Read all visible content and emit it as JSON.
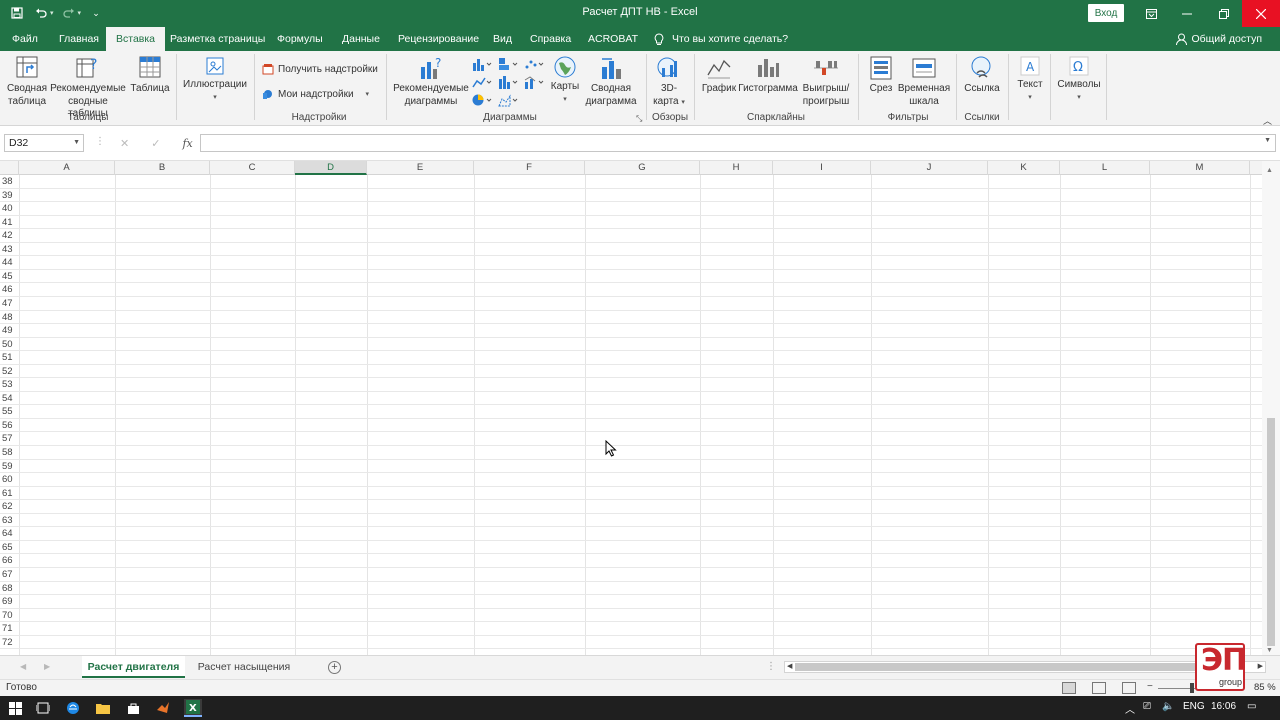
{
  "window": {
    "title": "Расчет ДПТ НВ  -  Excel",
    "signin_label": "Вход"
  },
  "tabs": [
    {
      "label": "Файл",
      "active": false
    },
    {
      "label": "Главная",
      "active": false
    },
    {
      "label": "Вставка",
      "active": true
    },
    {
      "label": "Разметка страницы",
      "active": false
    },
    {
      "label": "Формулы",
      "active": false
    },
    {
      "label": "Данные",
      "active": false
    },
    {
      "label": "Рецензирование",
      "active": false
    },
    {
      "label": "Вид",
      "active": false
    },
    {
      "label": "Справка",
      "active": false
    },
    {
      "label": "ACROBAT",
      "active": false
    }
  ],
  "tellme": "Что вы хотите сделать?",
  "share_label": "Общий доступ",
  "ribbon": {
    "pivot": [
      "Сводная",
      "таблица"
    ],
    "recpivot": [
      "Рекомендуемые",
      "сводные таблицы"
    ],
    "table": "Таблица",
    "group_tables": "Таблицы",
    "illustrations": "Иллюстрации",
    "get_addins": "Получить надстройки",
    "my_addins": "Мои надстройки",
    "group_addins": "Надстройки",
    "recchart": [
      "Рекомендуемые",
      "диаграммы"
    ],
    "maps": "Карты",
    "pivotchart": [
      "Сводная",
      "диаграмма"
    ],
    "group_charts": "Диаграммы",
    "map3d": [
      "3D-",
      "карта"
    ],
    "group_tours": "Обзоры",
    "spark_line": "График",
    "spark_column": "Гистограмма",
    "spark_winloss": [
      "Выигрыш/",
      "проигрыш"
    ],
    "group_sparklines": "Спарклайны",
    "slicer": "Срез",
    "timeline": [
      "Временная",
      "шкала"
    ],
    "group_filters": "Фильтры",
    "link": "Ссылка",
    "group_links": "Ссылки",
    "text": "Текст",
    "symbols": "Символы"
  },
  "formula_bar": {
    "name_box": "D32",
    "formula": ""
  },
  "columns": [
    "A",
    "B",
    "C",
    "D",
    "E",
    "F",
    "G",
    "H",
    "I",
    "J",
    "K",
    "L",
    "M"
  ],
  "selected_column": "D",
  "rows": [
    "38",
    "39",
    "40",
    "41",
    "42",
    "43",
    "44",
    "45",
    "46",
    "47",
    "48",
    "49",
    "50",
    "51",
    "52",
    "53",
    "54",
    "55",
    "56",
    "57",
    "58",
    "59",
    "60",
    "61",
    "62",
    "63",
    "64",
    "65",
    "66",
    "67",
    "68",
    "69",
    "70",
    "71",
    "72"
  ],
  "sheets": [
    {
      "label": "Расчет двигателя",
      "active": true
    },
    {
      "label": "Расчет насыщения",
      "active": false
    }
  ],
  "status": "Готово",
  "zoom_label": "85 %",
  "taskbar": {
    "lang": "ENG",
    "time": "16:06"
  },
  "watermark": {
    "big": "ЭП",
    "small": "group"
  },
  "colors": {
    "excel_green": "#217346",
    "close_red": "#e81123",
    "watermark_red": "#c8282e"
  }
}
